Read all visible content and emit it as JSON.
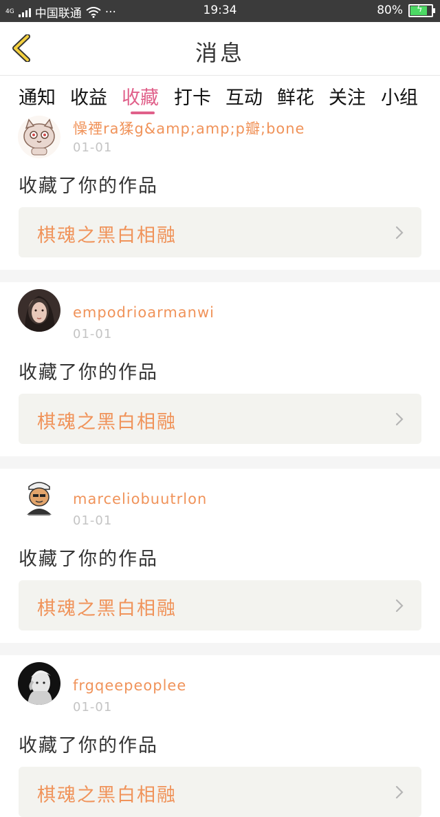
{
  "status_bar": {
    "network": "4G",
    "carrier": "中国联通",
    "more": "···",
    "time": "19:34",
    "battery": "80%",
    "battery_level": 0.8
  },
  "header": {
    "title": "消息",
    "back_icon": "chevron-left-icon"
  },
  "tabs": [
    {
      "label": "通知",
      "active": false
    },
    {
      "label": "收益",
      "active": false
    },
    {
      "label": "收藏",
      "active": true
    },
    {
      "label": "打卡",
      "active": false
    },
    {
      "label": "互动",
      "active": false
    },
    {
      "label": "鲜花",
      "active": false
    },
    {
      "label": "关注",
      "active": false
    },
    {
      "label": "小组",
      "active": false
    }
  ],
  "colors": {
    "accent": "#e0608a",
    "orange": "#f0935a",
    "card_bg": "#f3f3ef"
  },
  "items": [
    {
      "username": "懆禋ra猱g&amp;amp;p瓣;bone",
      "date": "01-01",
      "action": "收藏了你的作品",
      "work_title": "棋魂之黑白相融"
    },
    {
      "username": "empodrioarmanwi",
      "date": "01-01",
      "action": "收藏了你的作品",
      "work_title": "棋魂之黑白相融"
    },
    {
      "username": "marceliobuutrlon",
      "date": "01-01",
      "action": "收藏了你的作品",
      "work_title": "棋魂之黑白相融"
    },
    {
      "username": "frgqeepeoplee",
      "date": "01-01",
      "action": "收藏了你的作品",
      "work_title": "棋魂之黑白相融"
    }
  ]
}
